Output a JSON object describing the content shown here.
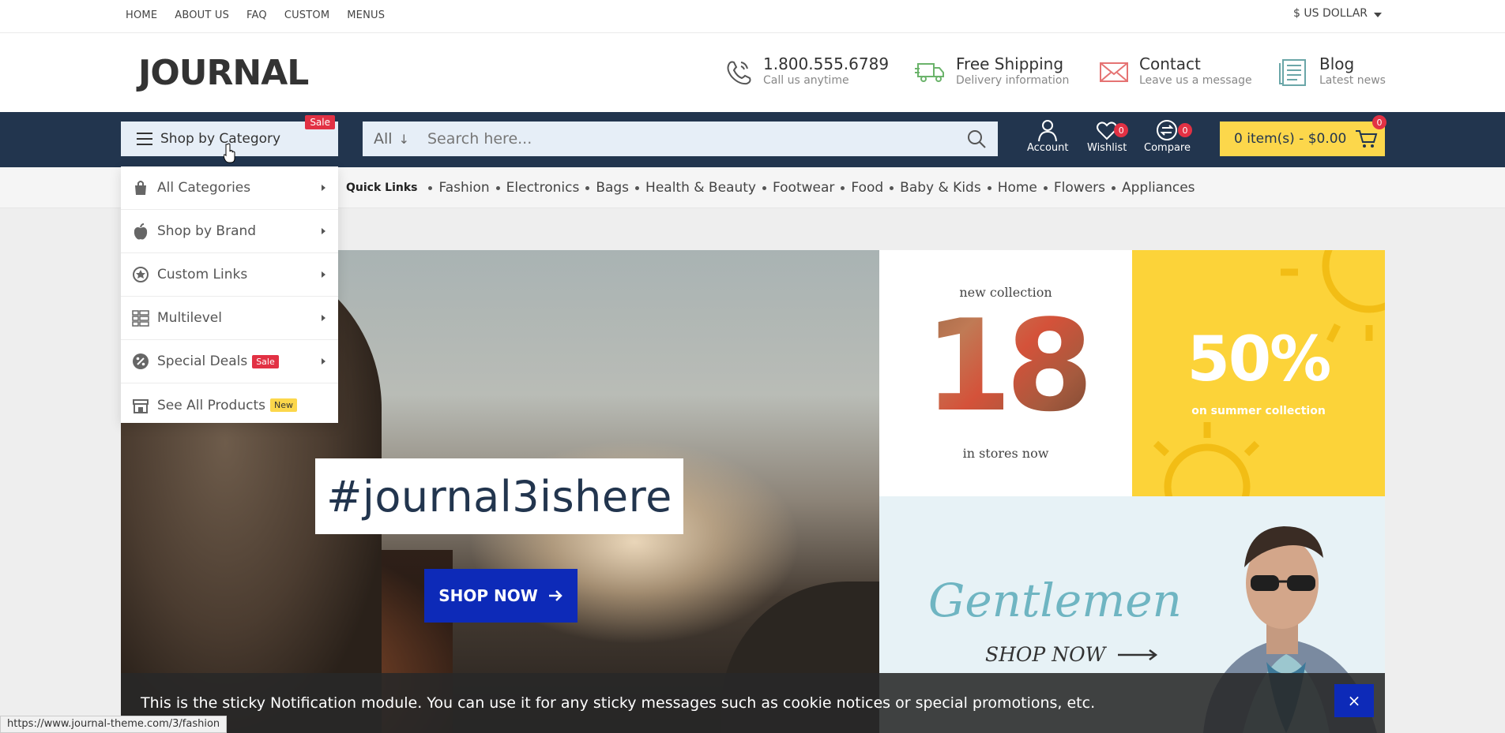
{
  "topbar": {
    "nav": [
      "HOME",
      "ABOUT US",
      "FAQ",
      "CUSTOM",
      "MENUS"
    ],
    "currency": "$ US DOLLAR"
  },
  "header": {
    "logo": "JOURNAL",
    "phone": {
      "title": "1.800.555.6789",
      "subtitle": "Call us anytime"
    },
    "shipping": {
      "title": "Free Shipping",
      "subtitle": "Delivery information"
    },
    "contact": {
      "title": "Contact",
      "subtitle": "Leave us a message"
    },
    "blog": {
      "title": "Blog",
      "subtitle": "Latest news"
    }
  },
  "mainbar": {
    "shop_by_category": "Shop by Category",
    "shop_badge": "Sale",
    "search_category": "All",
    "search_placeholder": "Search here...",
    "account_label": "Account",
    "wishlist_label": "Wishlist",
    "wishlist_count": "0",
    "compare_label": "Compare",
    "compare_count": "0",
    "cart_label": "0 item(s) - $0.00",
    "cart_count": "0"
  },
  "quick_links": {
    "title": "Quick Links",
    "items": [
      "Fashion",
      "Electronics",
      "Bags",
      "Health & Beauty",
      "Footwear",
      "Food",
      "Baby & Kids",
      "Home",
      "Flowers",
      "Appliances"
    ]
  },
  "dropdown": {
    "items": [
      {
        "label": "All Categories",
        "icon": "bag-icon",
        "tag": ""
      },
      {
        "label": "Shop by Brand",
        "icon": "apple-icon",
        "tag": ""
      },
      {
        "label": "Custom Links",
        "icon": "star-circle-icon",
        "tag": ""
      },
      {
        "label": "Multilevel",
        "icon": "grid-icon",
        "tag": ""
      },
      {
        "label": "Special Deals",
        "icon": "percent-icon",
        "tag": "Sale"
      },
      {
        "label": "See All Products",
        "icon": "store-icon",
        "tag": "New"
      }
    ]
  },
  "hero": {
    "hashtag": "#journal3ishere",
    "button": "SHOP NOW"
  },
  "banners": {
    "collection_top": "new collection",
    "collection_number": "18",
    "collection_bottom": "in stores now",
    "sale_percent": "50%",
    "sale_sub": "on summer collection",
    "gentlemen": "Gentlemen",
    "gentlemen_cta": "SHOP NOW"
  },
  "notification": {
    "text": "This is the sticky Notification module. You can use it for any sticky messages such as cookie notices or special promotions, etc.",
    "close": "×"
  },
  "status_url": "https://www.journal-theme.com/3/fashion",
  "colors": {
    "navy": "#22354e",
    "accent_yellow": "#fcd74b",
    "badge_red": "#e23144",
    "cta_blue": "#0d2ab8"
  }
}
